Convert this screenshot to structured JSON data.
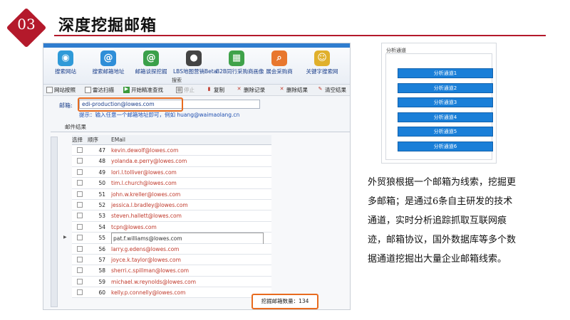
{
  "header": {
    "section_number": "03",
    "title": "深度挖掘邮箱",
    "accent_color": "#b4192b"
  },
  "ribbon": {
    "items": [
      {
        "label": "搜索网站",
        "icon": "globe-icon",
        "color": "#2f9ad8"
      },
      {
        "label": "搜索邮箱地址",
        "icon": "at-icon",
        "color": "#2f8ed8"
      },
      {
        "label": "邮箱谈探挖掘",
        "icon": "at-icon",
        "color": "#3aa04a"
      },
      {
        "label": "LBS地图营销Beta",
        "icon": "map-pin-icon",
        "color": "#444"
      },
      {
        "label": "B2B同行采购商画像",
        "icon": "grid-icon",
        "color": "#3fa24a"
      },
      {
        "label": "展会采购商",
        "icon": "search-icon",
        "color": "#e8772e"
      },
      {
        "label": "关键字搜索网",
        "icon": "face-icon",
        "color": "#e0b02c"
      }
    ],
    "group_label": "搜索"
  },
  "toolbar": {
    "site_filter": "网站按照",
    "multi_scan": "雷达扫描",
    "start_search": "开始精准查找",
    "stop": "停止",
    "copy": "复制",
    "delete_record": "删除记录",
    "delete_result": "删除结果",
    "clear_result": "清空结果"
  },
  "email_search": {
    "label": "邮箱:",
    "value": "edi-production@lowes.com",
    "hint": "提示：输入任意一个邮箱地址即可，例如",
    "hint_example": "huang@waimaolang.cn"
  },
  "results": {
    "tab_label": "邮件结果",
    "columns": [
      "选择",
      "顺序",
      "EMail"
    ],
    "rows": [
      {
        "no": "47",
        "email": "kevin.dewolf@lowes.com"
      },
      {
        "no": "48",
        "email": "yolanda.e.perry@lowes.com"
      },
      {
        "no": "49",
        "email": "lori.l.tolliver@lowes.com"
      },
      {
        "no": "50",
        "email": "tim.l.church@lowes.com"
      },
      {
        "no": "51",
        "email": "john.w.kreller@lowes.com"
      },
      {
        "no": "52",
        "email": "jessica.l.bradley@lowes.com"
      },
      {
        "no": "53",
        "email": "steven.hallett@lowes.com"
      },
      {
        "no": "54",
        "email": "tcpn@lowes.com"
      },
      {
        "no": "55",
        "email": "pat.f.williams@lowes.com"
      },
      {
        "no": "56",
        "email": "larry.g.edens@lowes.com"
      },
      {
        "no": "57",
        "email": "joyce.k.taylor@lowes.com"
      },
      {
        "no": "58",
        "email": "sherri.c.spillman@lowes.com"
      },
      {
        "no": "59",
        "email": "michael.w.reynolds@lowes.com"
      },
      {
        "no": "60",
        "email": "kelly.p.connelly@lowes.com"
      }
    ],
    "active_row": 8,
    "count_label": "挖掘邮箱数量：134"
  },
  "analysis_panel": {
    "title": "分析通道",
    "channels": [
      "分析通道1",
      "分析通道2",
      "分析通道3",
      "分析通道4",
      "分析通道5",
      "分析通道6"
    ]
  },
  "description": "外贸狼根据一个邮箱为线索，挖掘更多邮箱；是通过6条自主研发的技术通道，实时分析追踪抓取互联网痕迹，邮箱协议，国外数据库等多个数据通道挖掘出大量企业邮箱线索。"
}
